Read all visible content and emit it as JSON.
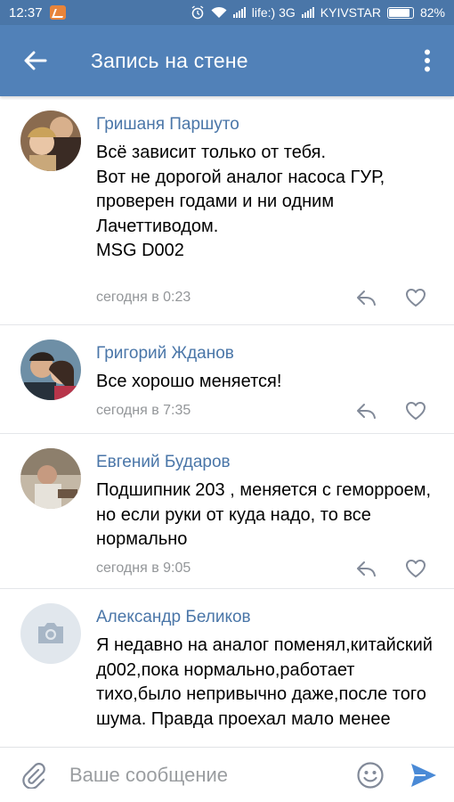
{
  "status_bar": {
    "time": "12:37",
    "carrier1": "life:) 3G",
    "carrier2": "KYIVSTAR",
    "battery": "82%",
    "battery_level": 0.82
  },
  "header": {
    "title": "Запись на стене",
    "back_icon": "arrow-left-icon",
    "menu_icon": "more-vertical-icon"
  },
  "comments": [
    {
      "author": "Гришаня Паршуто",
      "text": "Всё зависит только от тебя.\nВот не дорогой аналог насоса ГУР, проверен годами и ни одним Лачеттиводом.\nMSG D002",
      "time": "сегодня в 0:23"
    },
    {
      "author": "Григорий Жданов",
      "text": "Все хорошо меняется!",
      "time": "сегодня в 7:35"
    },
    {
      "author": "Евгений Бударов",
      "text": "Подшипник 203 , меняется с геморроем, но если руки от куда надо, то все нормально",
      "time": "сегодня в 9:05"
    },
    {
      "author": "Александр Беликов",
      "text": "Я недавно на аналог поменял,китайский д002,пока нормально,работает тихо,было непривычно даже,после того шума. Правда проехал мало менее",
      "time": ""
    }
  ],
  "composer": {
    "placeholder": "Ваше сообщение"
  },
  "colors": {
    "header": "#5181b8",
    "author": "#4a76a8",
    "meta": "#939699",
    "send": "#4a8ad6"
  }
}
